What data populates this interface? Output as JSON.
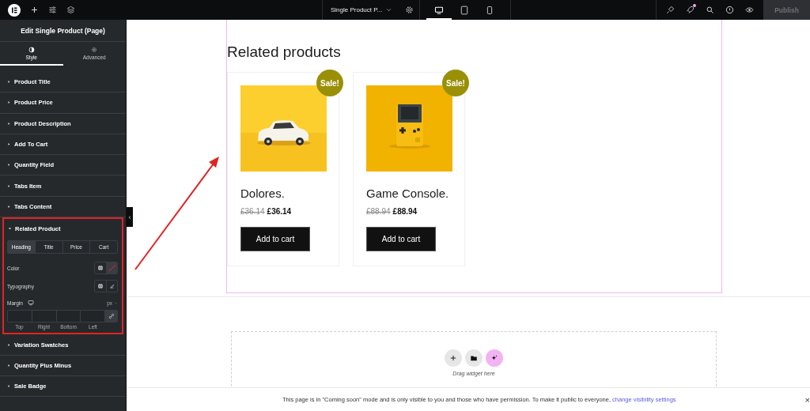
{
  "topbar": {
    "page_title": "Single Product P...",
    "devices": [
      {
        "kind": "desktop",
        "selected": true
      },
      {
        "kind": "tablet",
        "selected": false
      },
      {
        "kind": "mobile",
        "selected": false
      }
    ],
    "notification": true,
    "publish": {
      "label": "Publish",
      "disabled": true
    }
  },
  "sidebar": {
    "title": "Edit Single Product (Page)",
    "tabs": [
      {
        "label": "Style",
        "kind": "style",
        "selected": true
      },
      {
        "label": "Advanced",
        "kind": "advanced",
        "selected": false
      }
    ],
    "sections": [
      {
        "label": "Product Title",
        "expanded": false,
        "highlighted": false
      },
      {
        "label": "Product Price",
        "expanded": false,
        "highlighted": false
      },
      {
        "label": "Product Description",
        "expanded": false,
        "highlighted": false
      },
      {
        "label": "Add To Cart",
        "expanded": false,
        "highlighted": false
      },
      {
        "label": "Quantity Field",
        "expanded": false,
        "highlighted": false
      },
      {
        "label": "Tabs Item",
        "expanded": false,
        "highlighted": false
      },
      {
        "label": "Tabs Content",
        "expanded": false,
        "highlighted": false
      },
      {
        "label": "Related Product",
        "expanded": true,
        "highlighted": true,
        "subtabs": [
          {
            "label": "Heading",
            "selected": true
          },
          {
            "label": "Title",
            "selected": false
          },
          {
            "label": "Price",
            "selected": false
          },
          {
            "label": "Cart",
            "selected": false
          }
        ],
        "controls": [
          {
            "label": "Color",
            "kind": "color"
          },
          {
            "label": "Typography",
            "kind": "typography"
          },
          {
            "label": "Margin",
            "kind": "dimensions",
            "unit": "px",
            "sides": [
              "Top",
              "Right",
              "Bottom",
              "Left"
            ]
          }
        ]
      },
      {
        "label": "Variation Swatches",
        "expanded": false,
        "highlighted": false
      },
      {
        "label": "Quantity Plus Minus",
        "expanded": false,
        "highlighted": false
      },
      {
        "label": "Sale Badge",
        "expanded": false,
        "highlighted": false
      }
    ]
  },
  "canvas": {
    "heading": "Related products",
    "products": [
      {
        "kind": "car",
        "badge": "Sale!",
        "name": "Dolores.",
        "old_price": "£36.14",
        "price": "£36.14",
        "button": "Add to cart"
      },
      {
        "kind": "console",
        "badge": "Sale!",
        "name": "Game Console.",
        "old_price": "£88.94",
        "price": "£88.94",
        "button": "Add to cart"
      }
    ],
    "empty_section": {
      "hint": "Drag widget here"
    },
    "notice": {
      "text": "This page is in \"Coming soon\" mode and is only visible to you and those who have permission. To make it public to everyone,",
      "link": "change visibility settings",
      "close": "×"
    },
    "collapse": "‹"
  }
}
